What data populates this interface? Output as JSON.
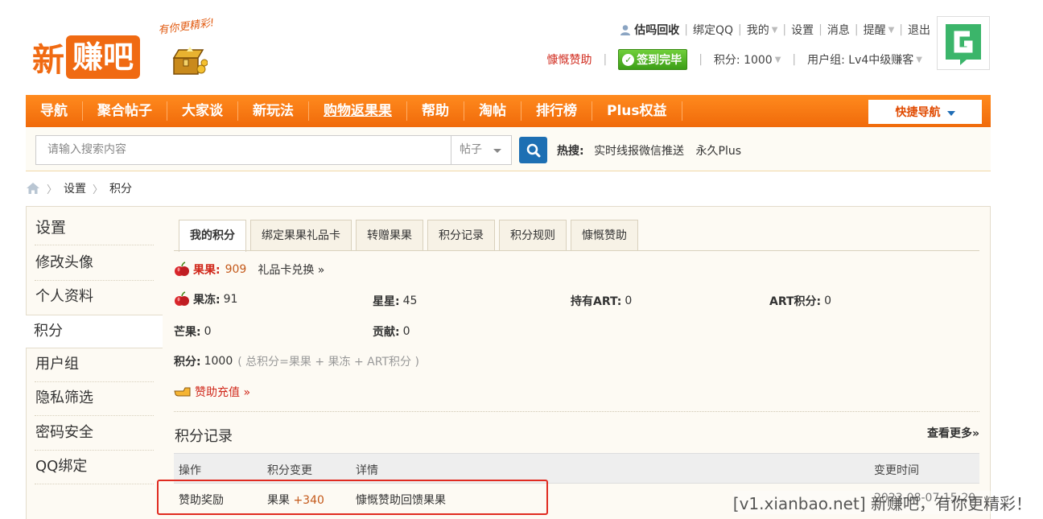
{
  "header": {
    "logo_xin": "新",
    "logo_box": "赚吧",
    "slogan": "有你更精彩!",
    "username": "估吗回收",
    "links": [
      "绑定QQ",
      "我的",
      "设置",
      "消息",
      "提醒",
      "退出"
    ],
    "sponsor_link": "慷慨赞助",
    "sign_button": "签到完毕",
    "points": "积分: 1000",
    "usergroup": "用户组: Lv4中级赚客"
  },
  "nav": {
    "items": [
      "导航",
      "聚合帖子",
      "大家谈",
      "新玩法",
      "购物返果果",
      "帮助",
      "淘帖",
      "排行榜",
      "Plus权益"
    ],
    "quick_nav": "快捷导航"
  },
  "search": {
    "placeholder": "请输入搜索内容",
    "type": "帖子",
    "hot_label": "热搜:",
    "hot_items": [
      "实时线报微信推送",
      "永久Plus"
    ]
  },
  "breadcrumb": [
    "设置",
    "积分"
  ],
  "sidebar": {
    "title": "设置",
    "items": [
      "修改头像",
      "个人资料",
      "积分",
      "用户组",
      "隐私筛选",
      "密码安全",
      "QQ绑定"
    ]
  },
  "tabs": [
    "我的积分",
    "绑定果果礼品卡",
    "转赠果果",
    "积分记录",
    "积分规则",
    "慷慨赞助"
  ],
  "credits": {
    "guoguo_label": "果果:",
    "guoguo_value": "909",
    "gift_link": "礼品卡兑换 »",
    "guodong_label": "果冻:",
    "guodong_value": "91",
    "xingxing_label": "星星:",
    "xingxing_value": "45",
    "art_label": "持有ART:",
    "art_value": "0",
    "artpoints_label": "ART积分:",
    "artpoints_value": "0",
    "mangguo_label": "芒果:",
    "mangguo_value": "0",
    "gongxian_label": "贡献:",
    "gongxian_value": "0",
    "total_label": "积分:",
    "total_value": "1000",
    "total_formula": "( 总积分=果果 + 果冻 + ART积分 )",
    "recharge_link": "赞助充值 »"
  },
  "records": {
    "title": "积分记录",
    "more": "查看更多»",
    "columns": [
      "操作",
      "积分变更",
      "详情",
      "变更时间"
    ],
    "rows": [
      {
        "action": "赞助奖励",
        "change_label": "果果",
        "change_value": "+340",
        "detail": "慷慨赞助回馈果果",
        "time": "2023-08-07 15:20"
      }
    ]
  },
  "watermark": "[v1.xianbao.net] 新赚吧，有你更精彩！",
  "colors": {
    "brand_orange": "#f06a12",
    "nav_orange": "#ff8a1e",
    "search_blue": "#1d6fb3",
    "sign_green": "#3c9e17",
    "highlight_red": "#e02b20"
  }
}
